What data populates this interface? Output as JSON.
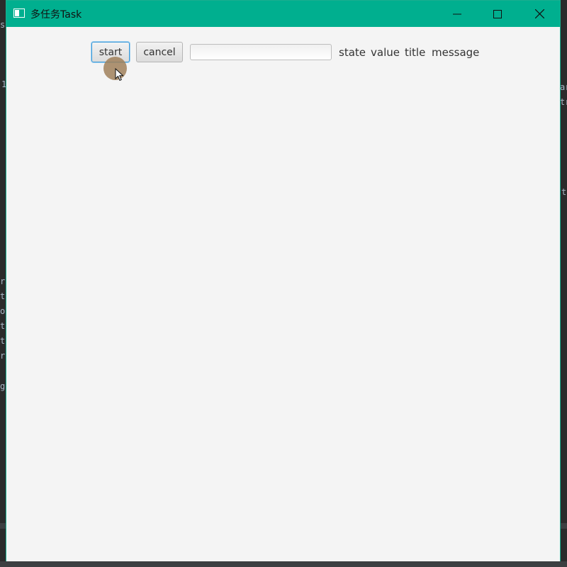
{
  "window": {
    "title": "多任务Task",
    "accent_color": "#00af8f",
    "controls": {
      "minimize_icon": "minimize-icon",
      "maximize_icon": "maximize-icon",
      "close_icon": "close-icon"
    }
  },
  "toolbar": {
    "start_label": "start",
    "cancel_label": "cancel",
    "text_field_value": "",
    "text_field_placeholder": ""
  },
  "labels": {
    "state": "state",
    "value": "value",
    "title": "title",
    "message": "message"
  },
  "background_editor": {
    "fragments": [
      "s",
      "1",
      "ar",
      "tr",
      "t",
      "r",
      "t",
      "o",
      "t",
      "t",
      "r",
      "g"
    ]
  }
}
